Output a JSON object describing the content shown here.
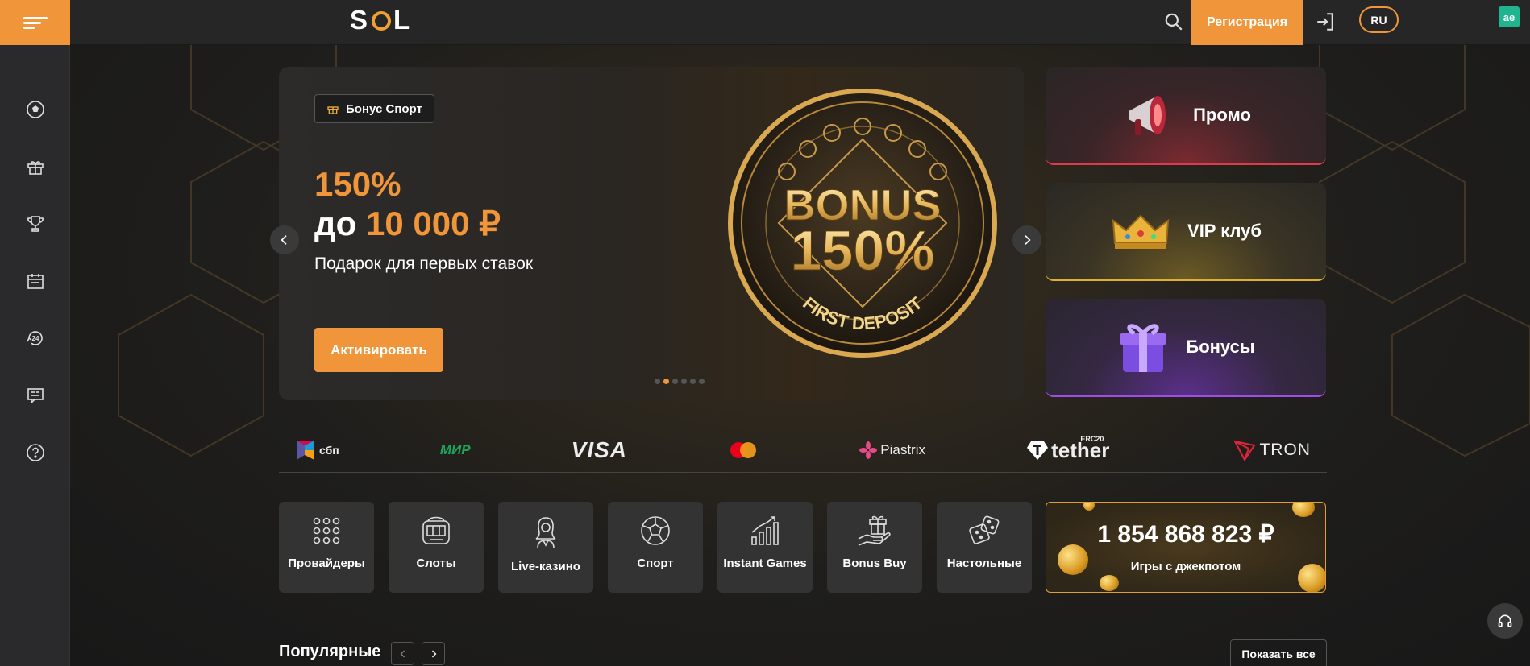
{
  "header": {
    "logo_left": "S",
    "logo_right": "L",
    "register_label": "Регистрация",
    "lang_label": "RU",
    "ext_badge": "ae"
  },
  "sidebar": {
    "items": [
      {
        "icon": "soccer-ball-icon"
      },
      {
        "icon": "gift-icon"
      },
      {
        "icon": "trophy-icon"
      },
      {
        "icon": "calendar-icon"
      },
      {
        "icon": "support-24-icon"
      },
      {
        "icon": "chat-icon"
      },
      {
        "icon": "help-icon"
      }
    ]
  },
  "hero": {
    "tag": "Бонус Спорт",
    "line1": "150%",
    "line2_prefix": "до ",
    "line2_amount": "10 000 ₽",
    "subtitle": "Подарок для первых ставок",
    "cta": "Активировать",
    "coin_title": "BONUS",
    "coin_percent": "150%",
    "coin_caption": "FIRST DEPOSIT",
    "slides_count": 6,
    "active_slide": 2
  },
  "promo_cards": [
    {
      "label": "Промо",
      "icon": "megaphone-icon"
    },
    {
      "label": "VIP клуб",
      "icon": "crown-icon"
    },
    {
      "label": "Бонусы",
      "icon": "giftbox-icon"
    }
  ],
  "payments": {
    "sbp": "сбп",
    "mir": "МИР",
    "visa": "VISA",
    "mastercard": "mastercard",
    "piastrix": "Piastrix",
    "tether": "tether",
    "tether_sup": "ERC20",
    "tron": "TRON"
  },
  "categories": [
    {
      "label": "Провайдеры",
      "icon": "grid-dots-icon"
    },
    {
      "label": "Слоты",
      "icon": "slot-machine-icon"
    },
    {
      "label": "Live-казино",
      "icon": "dealer-icon"
    },
    {
      "label": "Спорт",
      "icon": "soccer-ball-icon"
    },
    {
      "label": "Instant Games",
      "icon": "chart-up-icon"
    },
    {
      "label": "Bonus Buy",
      "icon": "gift-hand-icon"
    },
    {
      "label": "Настольные",
      "icon": "dice-icon"
    }
  ],
  "jackpot": {
    "amount": "1 854 868 823 ₽",
    "label": "Игры с джекпотом"
  },
  "popular": {
    "title": "Популярные",
    "show_all": "Показать все"
  },
  "colors": {
    "accent": "#f0953a",
    "background": "#1e1e1f"
  }
}
